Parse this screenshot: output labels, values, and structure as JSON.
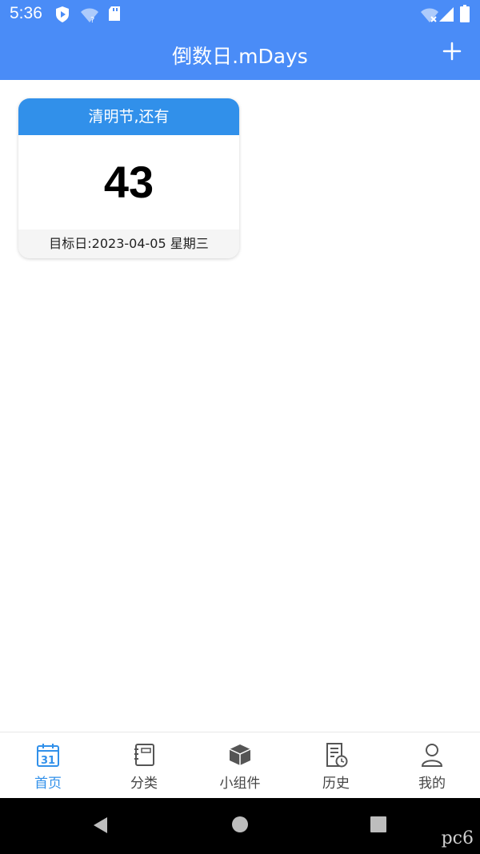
{
  "status_bar": {
    "time": "5:36"
  },
  "app_bar": {
    "title": "倒数日.mDays"
  },
  "card": {
    "header": "清明节,还有",
    "days": "43",
    "target": "目标日:2023-04-05 星期三"
  },
  "bottom_nav": {
    "items": [
      {
        "label": "首页",
        "icon": "calendar-icon",
        "active": true
      },
      {
        "label": "分类",
        "icon": "notebook-icon",
        "active": false
      },
      {
        "label": "小组件",
        "icon": "cube-icon",
        "active": false
      },
      {
        "label": "历史",
        "icon": "history-icon",
        "active": false
      },
      {
        "label": "我的",
        "icon": "user-icon",
        "active": false
      }
    ],
    "calendar_day": "31"
  },
  "watermark": "pc6",
  "colors": {
    "primary": "#4A8CF7",
    "accent": "#3190EA"
  }
}
